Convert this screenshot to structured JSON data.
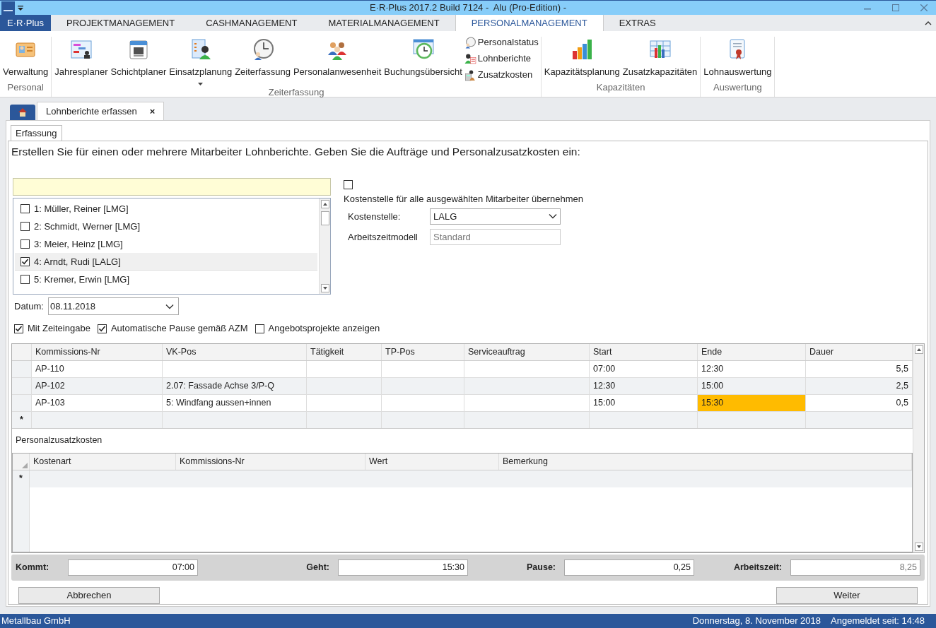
{
  "window": {
    "title": "E·R·Plus 2017.2 Build 7124 -  Alu (Pro-Edition) -"
  },
  "app_menu": "E·R·Plus",
  "ribbon_tabs": [
    {
      "label": "PROJEKTMANAGEMENT",
      "selected": false
    },
    {
      "label": "CASHMANAGEMENT",
      "selected": false
    },
    {
      "label": "MATERIALMANAGEMENT",
      "selected": false
    },
    {
      "label": "PERSONALMANAGEMENT",
      "selected": true
    },
    {
      "label": "EXTRAS",
      "selected": false
    }
  ],
  "ribbon_groups": [
    {
      "label": "Personal",
      "items": [
        {
          "label": "Verwaltung",
          "kind": "large",
          "has_menu": false
        }
      ]
    },
    {
      "label": "Zeiterfassung",
      "items": [
        {
          "label": "Jahresplaner",
          "kind": "large",
          "has_menu": false
        },
        {
          "label": "Schichtplaner",
          "kind": "large",
          "has_menu": false
        },
        {
          "label": "Einsatzplanung",
          "kind": "large",
          "has_menu": true
        },
        {
          "label": "Zeiterfassung",
          "kind": "large",
          "has_menu": false
        },
        {
          "label": "Personalanwesenheit",
          "kind": "large",
          "has_menu": false
        },
        {
          "label": "Buchungsübersicht",
          "kind": "large",
          "has_menu": false
        },
        {
          "label": "Personalstatus",
          "kind": "small"
        },
        {
          "label": "Lohnberichte",
          "kind": "small"
        },
        {
          "label": "Zusatzkosten",
          "kind": "small"
        }
      ]
    },
    {
      "label": "Kapazitäten",
      "items": [
        {
          "label": "Kapazitätsplanung",
          "kind": "large",
          "has_menu": false
        },
        {
          "label": "Zusatzkapazitäten",
          "kind": "large",
          "has_menu": false
        }
      ]
    },
    {
      "label": "Auswertung",
      "items": [
        {
          "label": "Lohnauswertung",
          "kind": "large",
          "has_menu": false
        }
      ]
    }
  ],
  "document_tab": {
    "label": "Lohnberichte erfassen",
    "close": "×"
  },
  "sub_tab": "Erfassung",
  "instruction": "Erstellen Sie für einen oder mehrere Mitarbeiter Lohnberichte. Geben Sie die Aufträge und Personalzusatzkosten ein:",
  "employees": [
    {
      "label": "1: Müller, Reiner [LMG]",
      "checked": false,
      "selected": false
    },
    {
      "label": "2: Schmidt, Werner [LMG]",
      "checked": false,
      "selected": false
    },
    {
      "label": "3: Meier, Heinz [LMG]",
      "checked": false,
      "selected": false
    },
    {
      "label": "4: Arndt, Rudi [LALG]",
      "checked": true,
      "selected": true
    },
    {
      "label": "5: Kremer, Erwin [LMG]",
      "checked": false,
      "selected": false
    }
  ],
  "apply_cost_center": {
    "label": "Kostenstelle für alle ausgewählten Mitarbeiter übernehmen",
    "checked": false
  },
  "cost_center": {
    "label": "Kostenstelle:",
    "value": "LALG"
  },
  "work_time_model": {
    "label": "Arbeitszeitmodell",
    "value": "Standard"
  },
  "date": {
    "label": "Datum:",
    "value": "08.11.2018"
  },
  "options": [
    {
      "label": "Mit Zeiteingabe",
      "checked": true
    },
    {
      "label": "Automatische Pause gemäß AZM",
      "checked": true
    },
    {
      "label": "Angebotsprojekte anzeigen",
      "checked": false
    }
  ],
  "orders": {
    "columns": [
      "Kommissions-Nr",
      "VK-Pos",
      "Tätigkeit",
      "TP-Pos",
      "Serviceauftrag",
      "Start",
      "Ende",
      "Dauer"
    ],
    "rows": [
      {
        "cells": [
          "AP-110",
          "",
          "",
          "",
          "",
          "07:00",
          "12:30",
          "5,5"
        ],
        "end_warning": false
      },
      {
        "cells": [
          "AP-102",
          "2.07: Fassade Achse 3/P-Q",
          "",
          "",
          "",
          "12:30",
          "15:00",
          "2,5"
        ],
        "end_warning": false
      },
      {
        "cells": [
          "AP-103",
          "5: Windfang aussen+innen",
          "",
          "",
          "",
          "15:00",
          "15:30",
          "0,5"
        ],
        "end_warning": true
      }
    ],
    "new_row_marker": "*"
  },
  "extra_costs": {
    "title": "Personalzusatzkosten",
    "columns": [
      "Kostenart",
      "Kommissions-Nr",
      "Wert",
      "Bemerkung"
    ],
    "new_row_marker": "*"
  },
  "totals": [
    {
      "label": "Kommt:",
      "value": "07:00",
      "disabled": false
    },
    {
      "label": "Geht:",
      "value": "15:30",
      "disabled": false
    },
    {
      "label": "Pause:",
      "value": "0,25",
      "disabled": false
    },
    {
      "label": "Arbeitszeit:",
      "value": "8,25",
      "disabled": true
    }
  ],
  "buttons": {
    "cancel": "Abbrechen",
    "next": "Weiter"
  },
  "status_bar": {
    "company": "Metallbau GmbH",
    "date": "Donnerstag, 8. November 2018",
    "login": "Angemeldet seit: 14:48"
  }
}
